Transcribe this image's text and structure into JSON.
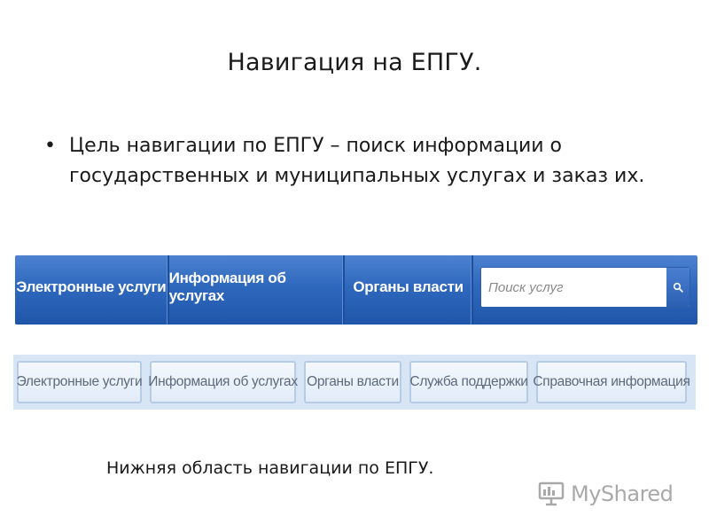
{
  "slide": {
    "title": "Навигация на ЕПГУ.",
    "bullet_symbol": "•",
    "bullet_text": "Цель навигации по ЕПГУ – поиск информации о государственных и муниципальных услугах и заказ их.",
    "caption": "Нижняя область навигации по ЕПГУ."
  },
  "top_nav": {
    "items": [
      {
        "label": "Электронные услуги"
      },
      {
        "label": "Информация об услугах"
      },
      {
        "label": "Органы власти"
      }
    ],
    "search": {
      "placeholder": "Поиск услуг",
      "button_icon": "search-icon"
    },
    "colors": {
      "bar": "#2e68bd",
      "text": "#ffffff"
    }
  },
  "bottom_nav": {
    "items": [
      {
        "label": "Электронные услуги"
      },
      {
        "label": "Информация об услугах"
      },
      {
        "label": "Органы власти"
      },
      {
        "label": "Служба поддержки"
      },
      {
        "label": "Справочная информация"
      }
    ],
    "colors": {
      "bar": "#d8e5f5",
      "text": "#5d6a7c"
    }
  },
  "watermark": {
    "text": "MyShared",
    "icon": "presentation-board-icon"
  }
}
